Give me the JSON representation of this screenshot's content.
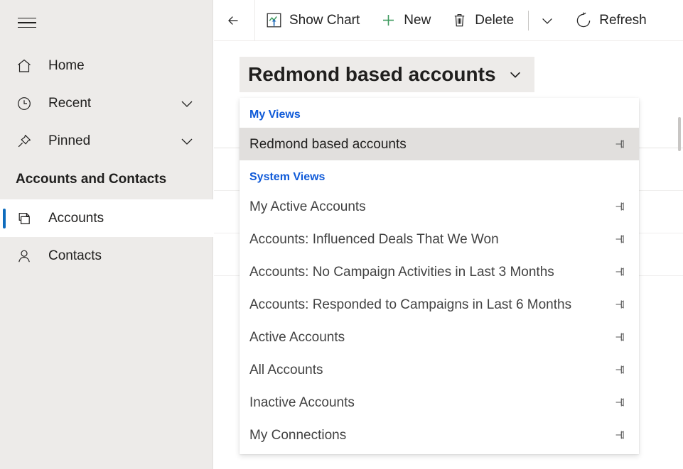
{
  "sidebar": {
    "menu_button": "hamburger-menu",
    "items": [
      {
        "label": "Home",
        "icon": "home-icon",
        "expandable": false,
        "selected": false
      },
      {
        "label": "Recent",
        "icon": "clock-icon",
        "expandable": true,
        "selected": false
      },
      {
        "label": "Pinned",
        "icon": "pin-icon",
        "expandable": true,
        "selected": false
      }
    ],
    "group_title": "Accounts and Contacts",
    "group_items": [
      {
        "label": "Accounts",
        "icon": "accounts-icon",
        "selected": true
      },
      {
        "label": "Contacts",
        "icon": "contact-person-icon",
        "selected": false
      }
    ],
    "selected_accent": "#0F6CBD",
    "background": "#EDEBE9"
  },
  "toolbar": {
    "back_label": "back-arrow",
    "buttons": [
      {
        "label": "Show Chart",
        "icon": "chart-icon"
      },
      {
        "label": "New",
        "icon": "plus-icon"
      },
      {
        "label": "Delete",
        "icon": "trash-icon"
      }
    ],
    "overflow_label": "chevron-down-icon",
    "refresh": {
      "label": "Refresh",
      "icon": "refresh-icon"
    },
    "new_icon_color": "#3E9A5F"
  },
  "view_selector": {
    "label": "Redmond based accounts",
    "chevron": "chevron-down-icon",
    "expanded": true,
    "background": "#EDEBE9"
  },
  "view_flyout": {
    "section_color": "#0F5AD8",
    "active_background": "#E1DFDD",
    "sections": [
      {
        "title": "My Views",
        "items": [
          {
            "label": "Redmond based accounts",
            "pin": "pin-icon",
            "active": true
          }
        ]
      },
      {
        "title": "System Views",
        "items": [
          {
            "label": "My Active Accounts",
            "pin": "pin-icon",
            "active": false
          },
          {
            "label": "Accounts: Influenced Deals That We Won",
            "pin": "pin-icon",
            "active": false
          },
          {
            "label": "Accounts: No Campaign Activities in Last 3 Months",
            "pin": "pin-icon",
            "active": false
          },
          {
            "label": "Accounts: Responded to Campaigns in Last 6 Months",
            "pin": "pin-icon",
            "active": false
          },
          {
            "label": "Active Accounts",
            "pin": "pin-icon",
            "active": false
          },
          {
            "label": "All Accounts",
            "pin": "pin-icon",
            "active": false
          },
          {
            "label": "Inactive Accounts",
            "pin": "pin-icon",
            "active": false
          },
          {
            "label": "My Connections",
            "pin": "pin-icon",
            "active": false
          }
        ]
      }
    ]
  }
}
